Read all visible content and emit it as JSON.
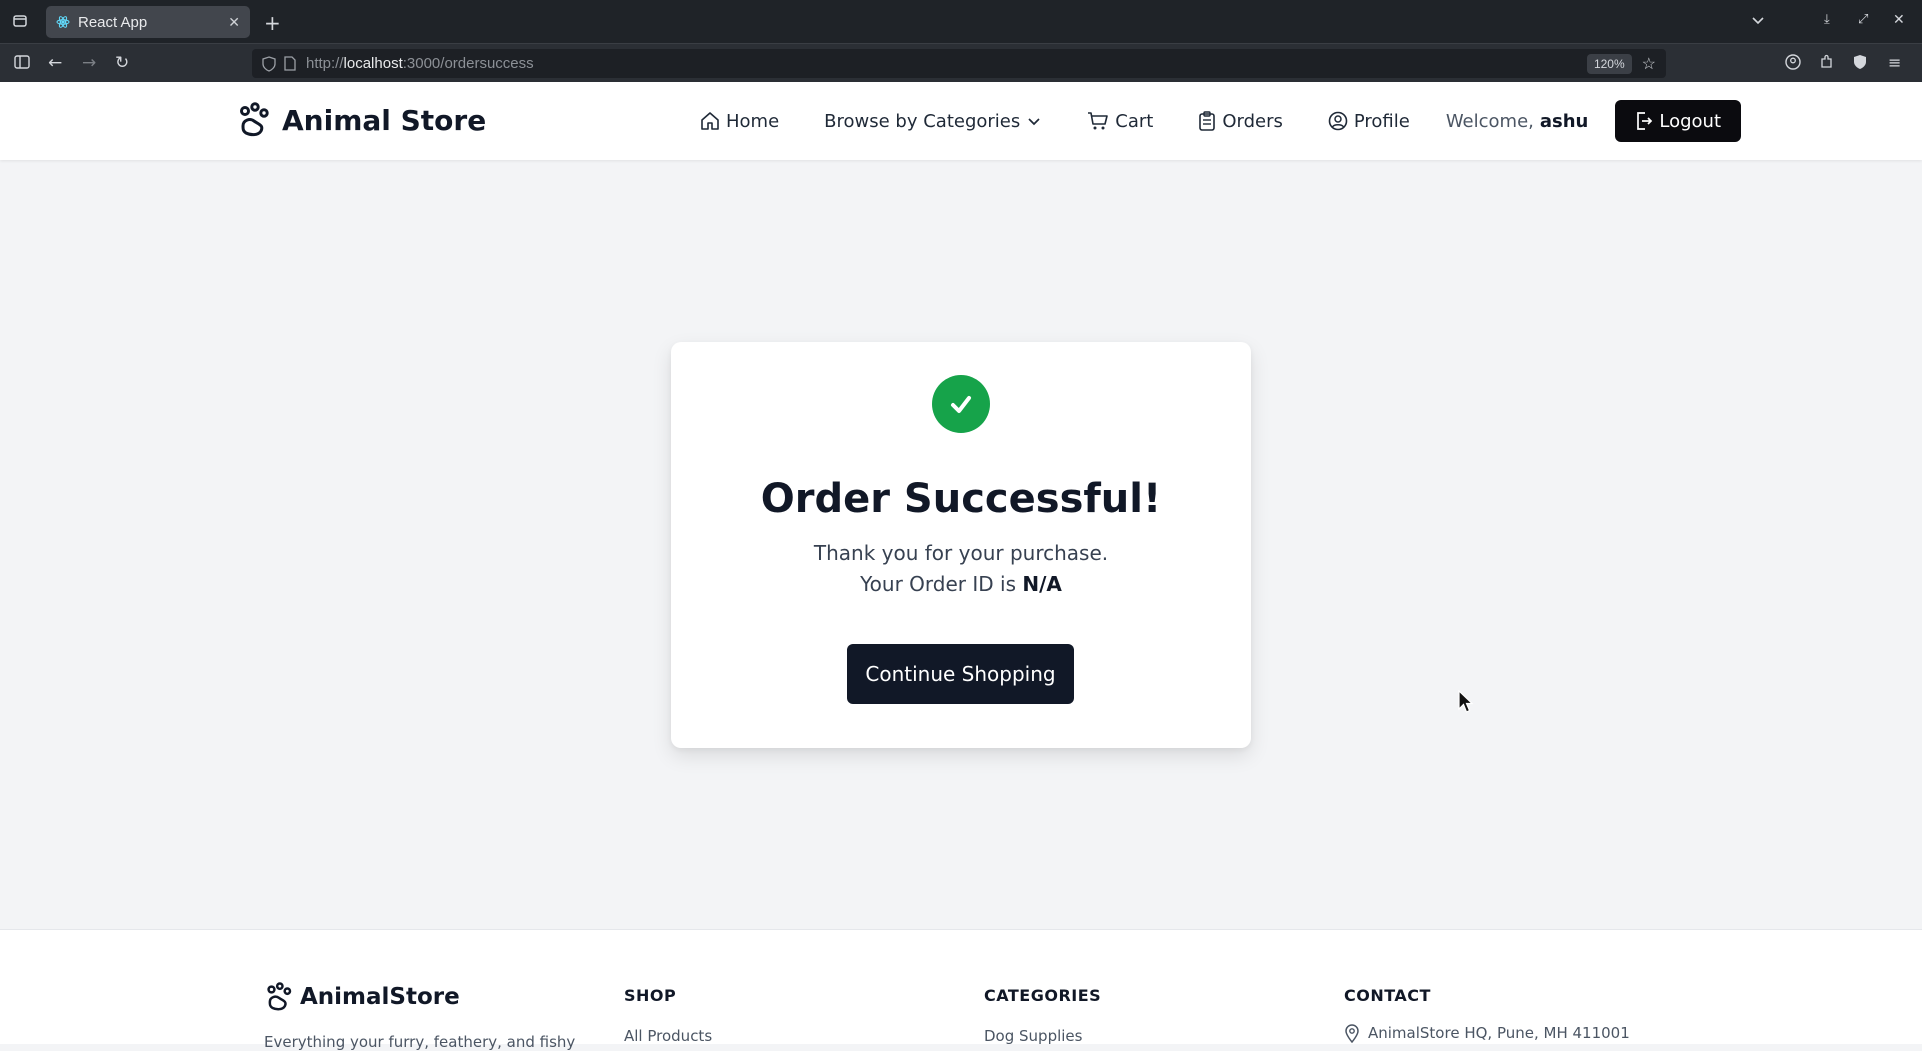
{
  "browser": {
    "tab_title": "React App",
    "url_prefix": "http://",
    "url_host": "localhost",
    "url_path": ":3000/ordersuccess",
    "zoom": "120%"
  },
  "header": {
    "brand": "Animal Store",
    "nav": {
      "home": "Home",
      "categories": "Browse by Categories",
      "cart": "Cart",
      "orders": "Orders",
      "profile": "Profile"
    },
    "welcome_label": "Welcome,",
    "username": "ashu",
    "logout_label": "Logout"
  },
  "main": {
    "title": "Order Successful!",
    "thanks": "Thank you for your purchase.",
    "order_id_label": "Your Order ID is",
    "order_id": "N/A",
    "continue_label": "Continue Shopping"
  },
  "footer": {
    "brand": "AnimalStore",
    "tagline": "Everything your furry, feathery, and fishy",
    "shop": {
      "heading": "SHOP",
      "first_link": "All Products"
    },
    "categories": {
      "heading": "CATEGORIES",
      "first_link": "Dog Supplies"
    },
    "contact": {
      "heading": "CONTACT",
      "address": "AnimalStore HQ, Pune, MH 411001"
    }
  },
  "colors": {
    "success": "#16a34a",
    "primary_dark": "#111827",
    "page_bg": "#f3f4f6"
  }
}
